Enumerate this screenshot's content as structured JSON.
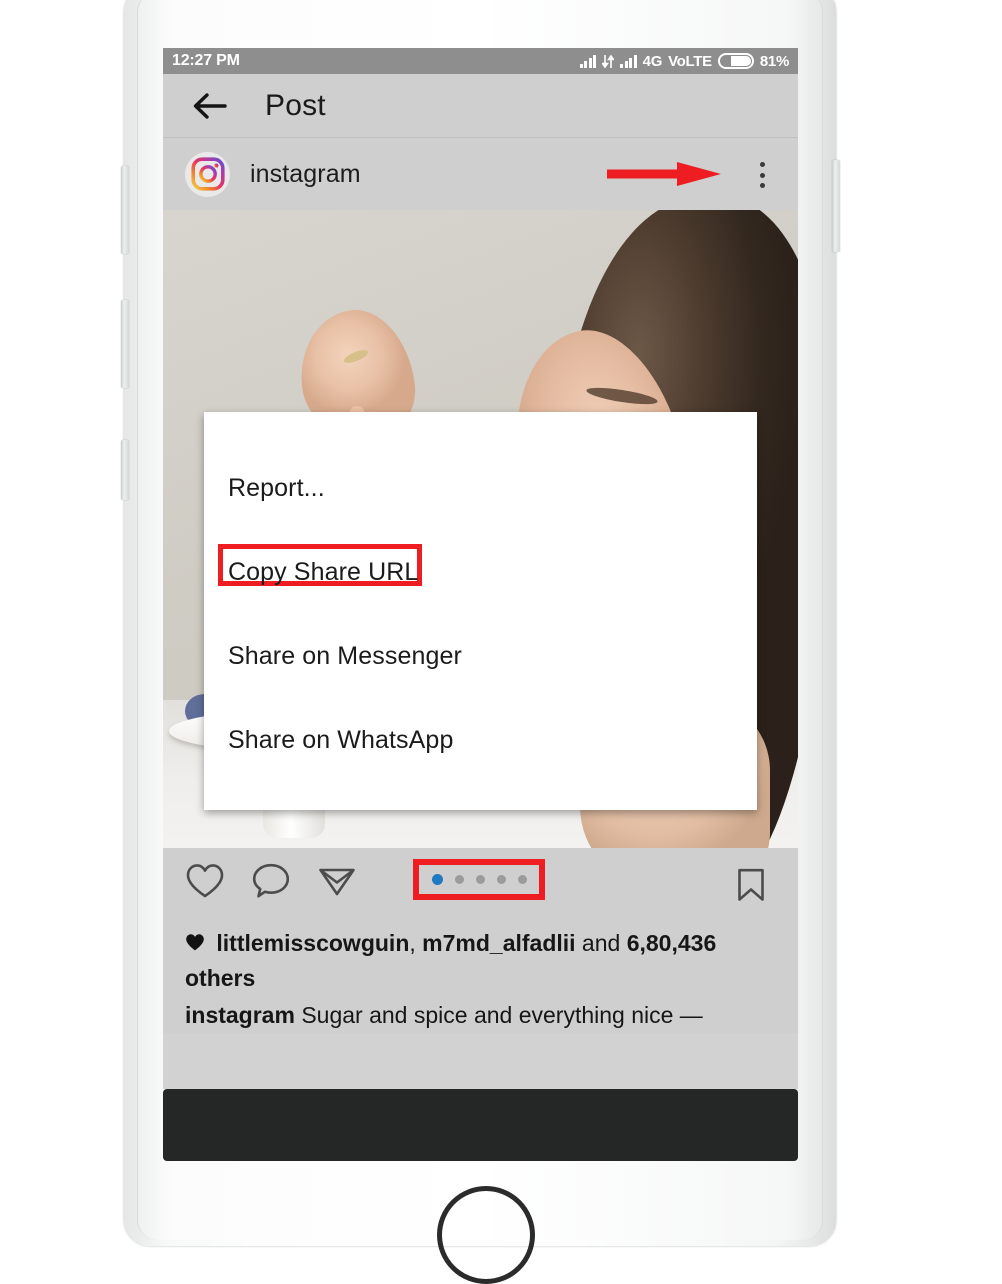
{
  "status_bar": {
    "time": "12:27 PM",
    "network_label": "4G",
    "volte_label": "VoLTE",
    "battery_percent": "81%",
    "icons": [
      "signal-bars-icon",
      "data-transfer-icon",
      "signal-bars-icon",
      "battery-icon"
    ]
  },
  "nav_bar": {
    "back_icon": "back-arrow-icon",
    "title": "Post"
  },
  "post_header": {
    "avatar_icon": "instagram-logo-avatar-icon",
    "username": "instagram",
    "more_options_icon": "three-dot-menu-icon",
    "annotation_icon": "red-arrow-annotation"
  },
  "share_menu": {
    "items": [
      {
        "label": "Report...",
        "highlighted": false
      },
      {
        "label": "Copy Share URL",
        "highlighted": true
      },
      {
        "label": "Share on Messenger",
        "highlighted": false
      },
      {
        "label": "Share on WhatsApp",
        "highlighted": false
      }
    ]
  },
  "action_bar": {
    "like_icon": "heart-icon",
    "comment_icon": "comment-bubble-icon",
    "share_icon": "paper-plane-icon",
    "bookmark_icon": "bookmark-icon",
    "carousel": {
      "total_dots": 5,
      "active_index": 1
    }
  },
  "post_meta": {
    "likes_heart_icon": "heart-filled-icon",
    "likes_user_1": "littlemisscowguin",
    "likes_separator": ", ",
    "likes_user_2": "m7md_alfadlii",
    "likes_and": " and ",
    "likes_count": "6,80,436",
    "likes_others": "others",
    "caption_author": "instagram",
    "caption_text": "Sugar and spice and everything nice —"
  },
  "annotation_colors": {
    "highlight_red": "#ee1d22",
    "carousel_active_blue": "#1f7ac2"
  },
  "device": {
    "frame_color": "#ffffff",
    "buttons": [
      "volume-up-button",
      "volume-down-button",
      "mute-button",
      "power-button",
      "home-button"
    ]
  }
}
